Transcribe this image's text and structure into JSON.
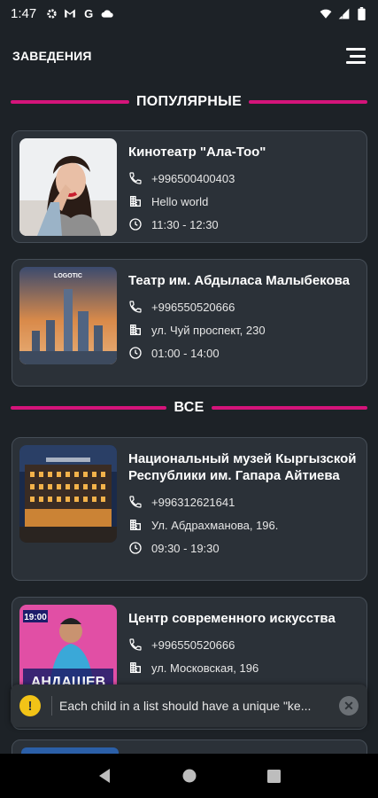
{
  "status_bar": {
    "time": "1:47"
  },
  "header": {
    "title": "ЗАВЕДЕНИЯ"
  },
  "sections": {
    "popular": "ПОПУЛЯРНЫЕ",
    "all": "ВСЕ"
  },
  "popular": [
    {
      "title": "Кинотеатр \"Ала-Тоо\"",
      "phone": "+996500400403",
      "address": "Hello world",
      "hours": "11:30 - 12:30"
    },
    {
      "title": "Театр им. Абдыласа Малыбекова",
      "phone": "+996550520666",
      "address": "ул. Чуй проспект, 230",
      "hours": "01:00 - 14:00"
    }
  ],
  "all": [
    {
      "title": "Национальный музей Кыргызской Республики им. Гапара Айтиева",
      "phone": "+996312621641",
      "address": "Ул. Абдрахманова, 196.",
      "hours": "09:30 - 19:30"
    },
    {
      "title": "Центр современного искусства",
      "phone": "+996550520666",
      "address": "ул. Московская, 196"
    }
  ],
  "images": {
    "poster_text": "АНДАШЕВ",
    "poster_time": "19:00",
    "city_text": "LOGOTIC"
  },
  "toast": {
    "message": "Each child in a list should have a unique \"ke..."
  },
  "colors": {
    "accent": "#d4147a",
    "background": "#1d2227",
    "card": "#2b3138",
    "warning": "#f2c317"
  }
}
